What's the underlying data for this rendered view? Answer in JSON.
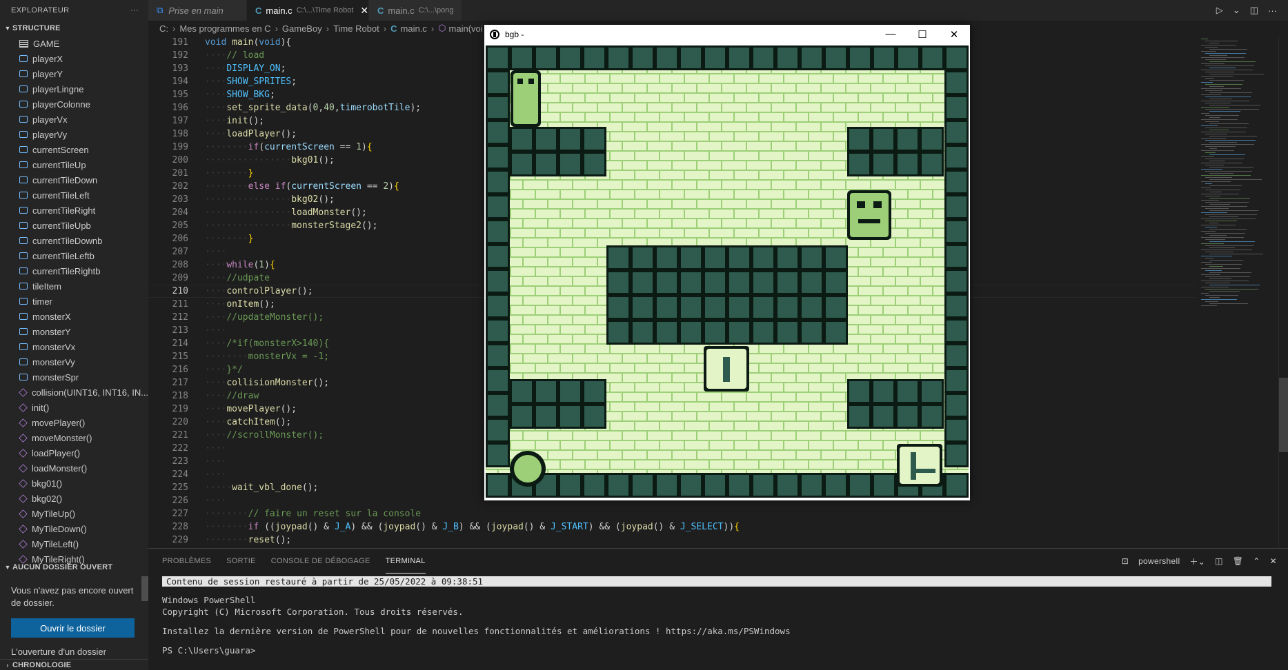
{
  "sidebar": {
    "title": "EXPLORATEUR",
    "more": "···",
    "outline_title": "STRUCTURE",
    "outline": [
      {
        "label": "GAME",
        "kind": "struct"
      },
      {
        "label": "playerX",
        "kind": "var"
      },
      {
        "label": "playerY",
        "kind": "var"
      },
      {
        "label": "playerLingne",
        "kind": "var"
      },
      {
        "label": "playerColonne",
        "kind": "var"
      },
      {
        "label": "playerVx",
        "kind": "var"
      },
      {
        "label": "playerVy",
        "kind": "var"
      },
      {
        "label": "currentScreen",
        "kind": "var"
      },
      {
        "label": "currentTileUp",
        "kind": "var"
      },
      {
        "label": "currentTileDown",
        "kind": "var"
      },
      {
        "label": "currentTileLeft",
        "kind": "var"
      },
      {
        "label": "currentTileRight",
        "kind": "var"
      },
      {
        "label": "currentTileUpb",
        "kind": "var"
      },
      {
        "label": "currentTileDownb",
        "kind": "var"
      },
      {
        "label": "currentTileLeftb",
        "kind": "var"
      },
      {
        "label": "currentTileRightb",
        "kind": "var"
      },
      {
        "label": "tileItem",
        "kind": "var"
      },
      {
        "label": "timer",
        "kind": "var"
      },
      {
        "label": "monsterX",
        "kind": "var"
      },
      {
        "label": "monsterY",
        "kind": "var"
      },
      {
        "label": "monsterVx",
        "kind": "var"
      },
      {
        "label": "monsterVy",
        "kind": "var"
      },
      {
        "label": "monsterSpr",
        "kind": "var"
      },
      {
        "label": "collision(UINT16, INT16, IN...",
        "kind": "fn"
      },
      {
        "label": "init()",
        "kind": "fn"
      },
      {
        "label": "movePlayer()",
        "kind": "fn"
      },
      {
        "label": "moveMonster()",
        "kind": "fn"
      },
      {
        "label": "loadPlayer()",
        "kind": "fn"
      },
      {
        "label": "loadMonster()",
        "kind": "fn"
      },
      {
        "label": "bkg01()",
        "kind": "fn"
      },
      {
        "label": "bkg02()",
        "kind": "fn"
      },
      {
        "label": "MyTileUp()",
        "kind": "fn"
      },
      {
        "label": "MyTileDown()",
        "kind": "fn"
      },
      {
        "label": "MyTileLeft()",
        "kind": "fn"
      },
      {
        "label": "MyTileRight()",
        "kind": "fn"
      }
    ],
    "no_folder_title": "AUCUN DOSSIER OUVERT",
    "no_folder_text": "Vous n'avez pas encore ouvert de dossier.",
    "open_folder_button": "Ouvrir le dossier",
    "open_folder_text2": "L'ouverture d'un dossier",
    "timeline_title": "CHRONOLOGIE"
  },
  "tabs": [
    {
      "label": "Prise en main",
      "path": "",
      "active": false,
      "italic": true
    },
    {
      "label": "main.c",
      "path": "C:\\...\\Time Robot",
      "active": true,
      "italic": false
    },
    {
      "label": "main.c",
      "path": "C:\\...\\pong",
      "active": false,
      "italic": false
    }
  ],
  "breadcrumb": [
    "C:",
    "Mes programmes en C",
    "GameBoy",
    "Time Robot",
    "main.c",
    "main(voi"
  ],
  "editor": {
    "current_line": 210,
    "lines": [
      {
        "n": 191,
        "t": [
          [
            "k",
            "void "
          ],
          [
            "f",
            "main"
          ],
          [
            "p",
            "("
          ],
          [
            "k",
            "void"
          ],
          [
            "p",
            "){"
          ]
        ]
      },
      {
        "n": 192,
        "t": [
          [
            "p",
            "····"
          ],
          [
            "c",
            "// load"
          ]
        ]
      },
      {
        "n": 193,
        "t": [
          [
            "p",
            "····"
          ],
          [
            "m",
            "DISPLAY_ON"
          ],
          [
            "p",
            ";"
          ]
        ]
      },
      {
        "n": 194,
        "t": [
          [
            "p",
            "····"
          ],
          [
            "m",
            "SHOW_SPRITES"
          ],
          [
            "p",
            ";"
          ]
        ]
      },
      {
        "n": 195,
        "t": [
          [
            "p",
            "····"
          ],
          [
            "m",
            "SHOW_BKG"
          ],
          [
            "p",
            ";"
          ]
        ]
      },
      {
        "n": 196,
        "t": [
          [
            "p",
            "····"
          ],
          [
            "f",
            "set_sprite_data"
          ],
          [
            "p",
            "("
          ],
          [
            "n",
            "0"
          ],
          [
            "p",
            ","
          ],
          [
            "n",
            "40"
          ],
          [
            "p",
            ","
          ],
          [
            "v",
            "timerobotTile"
          ],
          [
            "p",
            ");"
          ]
        ]
      },
      {
        "n": 197,
        "t": [
          [
            "p",
            "····"
          ],
          [
            "f",
            "init"
          ],
          [
            "p",
            "();"
          ]
        ]
      },
      {
        "n": 198,
        "t": [
          [
            "p",
            "····"
          ],
          [
            "f",
            "loadPlayer"
          ],
          [
            "p",
            "();"
          ]
        ]
      },
      {
        "n": 199,
        "t": [
          [
            "p",
            "········"
          ],
          [
            "pu",
            "if"
          ],
          [
            "p",
            "("
          ],
          [
            "v",
            "currentScreen"
          ],
          [
            "p",
            " == "
          ],
          [
            "n",
            "1"
          ],
          [
            "p",
            ")"
          ],
          [
            "y",
            "{"
          ]
        ]
      },
      {
        "n": 200,
        "t": [
          [
            "p",
            "················"
          ],
          [
            "f",
            "bkg01"
          ],
          [
            "p",
            "();"
          ]
        ]
      },
      {
        "n": 201,
        "t": [
          [
            "p",
            "········"
          ],
          [
            "y",
            "}"
          ]
        ]
      },
      {
        "n": 202,
        "t": [
          [
            "p",
            "········"
          ],
          [
            "pu",
            "else if"
          ],
          [
            "p",
            "("
          ],
          [
            "v",
            "currentScreen"
          ],
          [
            "p",
            " == "
          ],
          [
            "n",
            "2"
          ],
          [
            "p",
            ")"
          ],
          [
            "y",
            "{"
          ]
        ]
      },
      {
        "n": 203,
        "t": [
          [
            "p",
            "················"
          ],
          [
            "f",
            "bkg02"
          ],
          [
            "p",
            "();"
          ]
        ]
      },
      {
        "n": 204,
        "t": [
          [
            "p",
            "················"
          ],
          [
            "f",
            "loadMonster"
          ],
          [
            "p",
            "();"
          ]
        ]
      },
      {
        "n": 205,
        "t": [
          [
            "p",
            "················"
          ],
          [
            "f",
            "monsterStage2"
          ],
          [
            "p",
            "();"
          ]
        ]
      },
      {
        "n": 206,
        "t": [
          [
            "p",
            "········"
          ],
          [
            "y",
            "}"
          ]
        ]
      },
      {
        "n": 207,
        "t": [
          [
            "p",
            "····"
          ]
        ]
      },
      {
        "n": 208,
        "t": [
          [
            "p",
            "····"
          ],
          [
            "pu",
            "while"
          ],
          [
            "p",
            "("
          ],
          [
            "n",
            "1"
          ],
          [
            "p",
            ")"
          ],
          [
            "y",
            "{"
          ]
        ]
      },
      {
        "n": 209,
        "t": [
          [
            "p",
            "····"
          ],
          [
            "c",
            "//udpate"
          ]
        ]
      },
      {
        "n": 210,
        "t": [
          [
            "p",
            "····"
          ],
          [
            "f",
            "controlPlayer"
          ],
          [
            "p",
            "();"
          ]
        ]
      },
      {
        "n": 211,
        "t": [
          [
            "p",
            "····"
          ],
          [
            "f",
            "onItem"
          ],
          [
            "p",
            "();"
          ]
        ]
      },
      {
        "n": 212,
        "t": [
          [
            "p",
            "····"
          ],
          [
            "c",
            "//updateMonster();"
          ]
        ]
      },
      {
        "n": 213,
        "t": [
          [
            "p",
            "····"
          ]
        ]
      },
      {
        "n": 214,
        "t": [
          [
            "p",
            "····"
          ],
          [
            "c",
            "/*if(monsterX>140){"
          ]
        ]
      },
      {
        "n": 215,
        "t": [
          [
            "p",
            "········"
          ],
          [
            "c",
            "monsterVx = -1;"
          ]
        ]
      },
      {
        "n": 216,
        "t": [
          [
            "p",
            "····"
          ],
          [
            "c",
            "}*/"
          ]
        ]
      },
      {
        "n": 217,
        "t": [
          [
            "p",
            "····"
          ],
          [
            "f",
            "collisionMonster"
          ],
          [
            "p",
            "();"
          ]
        ]
      },
      {
        "n": 218,
        "t": [
          [
            "p",
            "····"
          ],
          [
            "c",
            "//draw"
          ]
        ]
      },
      {
        "n": 219,
        "t": [
          [
            "p",
            "····"
          ],
          [
            "f",
            "movePlayer"
          ],
          [
            "p",
            "();"
          ]
        ]
      },
      {
        "n": 220,
        "t": [
          [
            "p",
            "····"
          ],
          [
            "f",
            "catchItem"
          ],
          [
            "p",
            "();"
          ]
        ]
      },
      {
        "n": 221,
        "t": [
          [
            "p",
            "····"
          ],
          [
            "c",
            "//scrollMonster();"
          ]
        ]
      },
      {
        "n": 222,
        "t": [
          [
            "p",
            "····"
          ]
        ]
      },
      {
        "n": 223,
        "t": [
          [
            "p",
            "····"
          ]
        ]
      },
      {
        "n": 224,
        "t": [
          [
            "p",
            "····"
          ]
        ]
      },
      {
        "n": 225,
        "t": [
          [
            "p",
            "·····"
          ],
          [
            "f",
            "wait_vbl_done"
          ],
          [
            "p",
            "();"
          ]
        ]
      },
      {
        "n": 226,
        "t": [
          [
            "p",
            "····"
          ]
        ]
      },
      {
        "n": 227,
        "t": [
          [
            "p",
            "········"
          ],
          [
            "c",
            "// faire un reset sur la console"
          ]
        ]
      },
      {
        "n": 228,
        "t": [
          [
            "p",
            "········"
          ],
          [
            "pu",
            "if "
          ],
          [
            "p",
            "(("
          ],
          [
            "f",
            "joypad"
          ],
          [
            "p",
            "() & "
          ],
          [
            "m",
            "J_A"
          ],
          [
            "p",
            ") && ("
          ],
          [
            "f",
            "joypad"
          ],
          [
            "p",
            "() & "
          ],
          [
            "m",
            "J_B"
          ],
          [
            "p",
            ") && ("
          ],
          [
            "f",
            "joypad"
          ],
          [
            "p",
            "() & "
          ],
          [
            "m",
            "J_START"
          ],
          [
            "p",
            ") && ("
          ],
          [
            "f",
            "joypad"
          ],
          [
            "p",
            "() & "
          ],
          [
            "m",
            "J_SELECT"
          ],
          [
            "p",
            "))"
          ],
          [
            "y",
            "{"
          ]
        ]
      },
      {
        "n": 229,
        "t": [
          [
            "p",
            "········"
          ],
          [
            "f",
            "reset"
          ],
          [
            "p",
            "();"
          ]
        ]
      }
    ]
  },
  "emulator": {
    "title": "bgb -",
    "minimize": "—",
    "maximize": "☐",
    "close": "✕",
    "palette": {
      "light": "#e3f5c6",
      "mid": "#9ccf77",
      "dark": "#2e5b4d",
      "darkest": "#0b1a12"
    }
  },
  "panel": {
    "tabs": [
      "PROBLÈMES",
      "SORTIE",
      "CONSOLE DE DÉBOGAGE",
      "TERMINAL"
    ],
    "active_tab": "TERMINAL",
    "shell": "powershell",
    "terminal_lines": [
      "Contenu de session restauré à partir de 25/05/2022 à 09:38:51",
      "",
      "Windows PowerShell",
      "Copyright (C) Microsoft Corporation. Tous droits réservés.",
      "",
      "Installez la dernière version de PowerShell pour de nouvelles fonctionnalités et améliorations ! https://aka.ms/PSWindows",
      "",
      "PS C:\\Users\\guara>"
    ]
  }
}
